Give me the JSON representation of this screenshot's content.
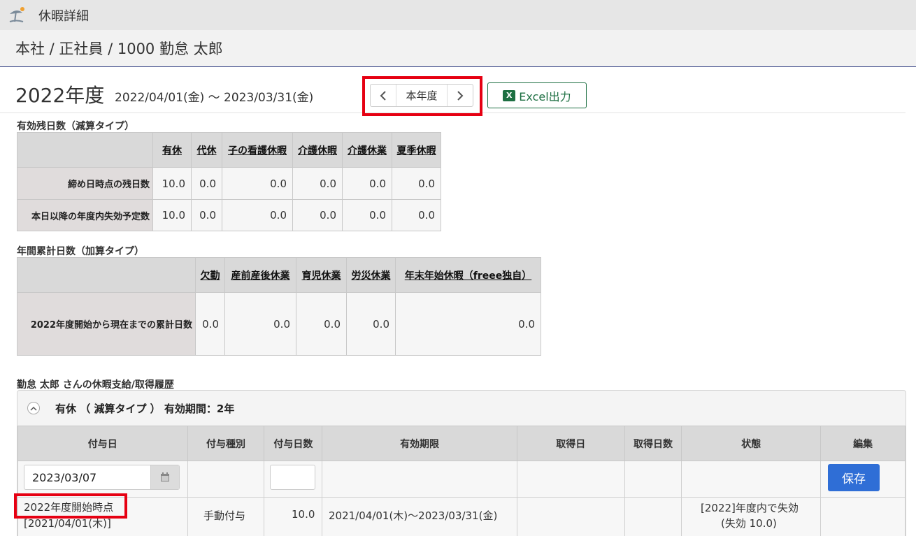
{
  "app": {
    "title": "休暇詳細",
    "icon": "beach-umbrella-icon"
  },
  "breadcrumb": "本社 / 正社員 / 1000 勤怠 太郎",
  "year": {
    "label": "2022年度",
    "period": "2022/04/01(金) ～ 2023/03/31(金)"
  },
  "nav": {
    "prev_icon": "chevron-left-icon",
    "current_label": "本年度",
    "next_icon": "chevron-right-icon"
  },
  "excel": {
    "label": "Excel出力",
    "icon": "excel-icon"
  },
  "deduction": {
    "title": "有効残日数（減算タイプ）",
    "columns": [
      "有休",
      "代休",
      "子の看護休暇",
      "介護休暇",
      "介護休業",
      "夏季休暇"
    ],
    "rows": [
      {
        "label": "締め日時点の残日数",
        "values": [
          "10.0",
          "0.0",
          "0.0",
          "0.0",
          "0.0",
          "0.0"
        ]
      },
      {
        "label": "本日以降の年度内失効予定数",
        "values": [
          "10.0",
          "0.0",
          "0.0",
          "0.0",
          "0.0",
          "0.0"
        ]
      }
    ]
  },
  "cumulative": {
    "title": "年間累計日数（加算タイプ）",
    "columns": [
      "欠勤",
      "産前産後休業",
      "育児休業",
      "労災休業",
      "年末年始休暇（freee独自）"
    ],
    "rows": [
      {
        "label": "2022年度開始から現在までの累計日数",
        "values": [
          "0.0",
          "0.0",
          "0.0",
          "0.0",
          "0.0"
        ]
      }
    ]
  },
  "history": {
    "title": "勤怠 太郎 さんの休暇支給/取得履歴",
    "group_title": "有休 （ 減算タイプ ） 有効期間：2年",
    "columns": [
      "付与日",
      "付与種別",
      "付与日数",
      "有効期限",
      "取得日",
      "取得日数",
      "状態",
      "編集"
    ],
    "new_row": {
      "date_value": "2023/03/07",
      "days_value": "",
      "save_label": "保存"
    },
    "rows": [
      {
        "grant_date_line1": "2022年度開始時点",
        "grant_date_line2": "[2021/04/01(木)]",
        "grant_type": "手動付与",
        "grant_days": "10.0",
        "expiry": "2021/04/01(木)～2023/03/31(金)",
        "taken_date": "",
        "taken_days": "",
        "status_line1": "[2022]年度内で失効",
        "status_line2": "(失効 10.0)"
      }
    ]
  },
  "colors": {
    "highlight": "#e60012",
    "save_button": "#2f6ed6",
    "excel_green": "#1d6f42"
  }
}
